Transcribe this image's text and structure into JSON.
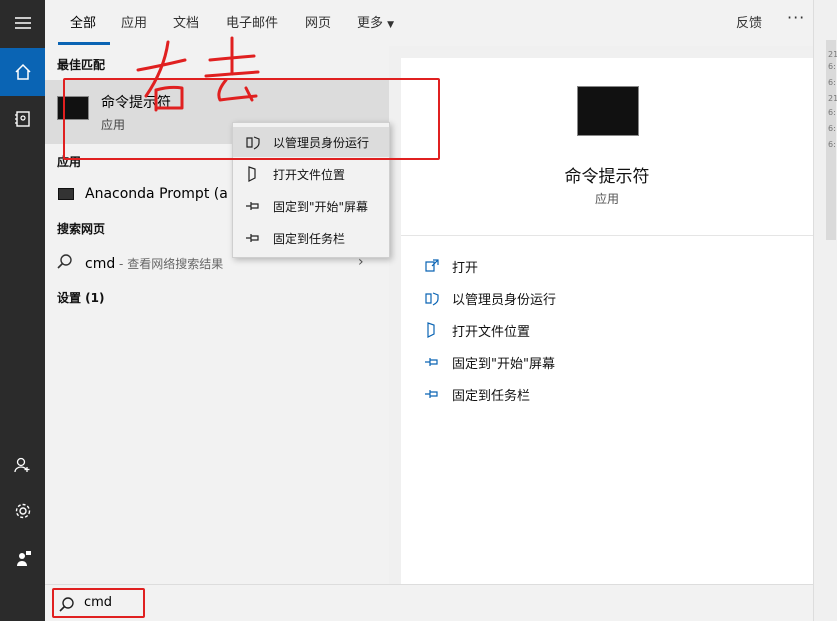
{
  "tabs": [
    {
      "label": "全部",
      "active": true
    },
    {
      "label": "应用"
    },
    {
      "label": "文档"
    },
    {
      "label": "电子邮件"
    },
    {
      "label": "网页"
    },
    {
      "label": "更多"
    }
  ],
  "header": {
    "feedback": "反馈",
    "more_options": "···"
  },
  "sections": {
    "best_match": "最佳匹配",
    "apps": "应用",
    "search_web": "搜索网页",
    "settings": "设置 (1)"
  },
  "best_match_item": {
    "name": "命令提示符",
    "type": "应用"
  },
  "app_item": {
    "name": "Anaconda Prompt (a"
  },
  "web_item": {
    "query": "cmd",
    "desc": " - 查看网络搜索结果"
  },
  "context_menu": [
    {
      "label": "以管理员身份运行",
      "icon": "shield-icon"
    },
    {
      "label": "打开文件位置",
      "icon": "folder-icon"
    },
    {
      "label": "固定到\"开始\"屏幕",
      "icon": "pin-icon"
    },
    {
      "label": "固定到任务栏",
      "icon": "pin-icon"
    }
  ],
  "preview": {
    "title": "命令提示符",
    "subtitle": "应用",
    "actions": [
      {
        "label": "打开",
        "icon": "open-icon"
      },
      {
        "label": "以管理员身份运行",
        "icon": "shield-icon"
      },
      {
        "label": "打开文件位置",
        "icon": "folder-icon"
      },
      {
        "label": "固定到\"开始\"屏幕",
        "icon": "pin-icon"
      },
      {
        "label": "固定到任务栏",
        "icon": "pin-icon"
      }
    ]
  },
  "search": {
    "value": "cmd"
  },
  "annotation": {
    "handwriting": "右击",
    "color": "#e02020"
  },
  "accent_color": "#0a64b4",
  "edge_fragments": [
    "21",
    "6:",
    "6:",
    "21",
    "6:",
    "6:",
    "6:"
  ]
}
